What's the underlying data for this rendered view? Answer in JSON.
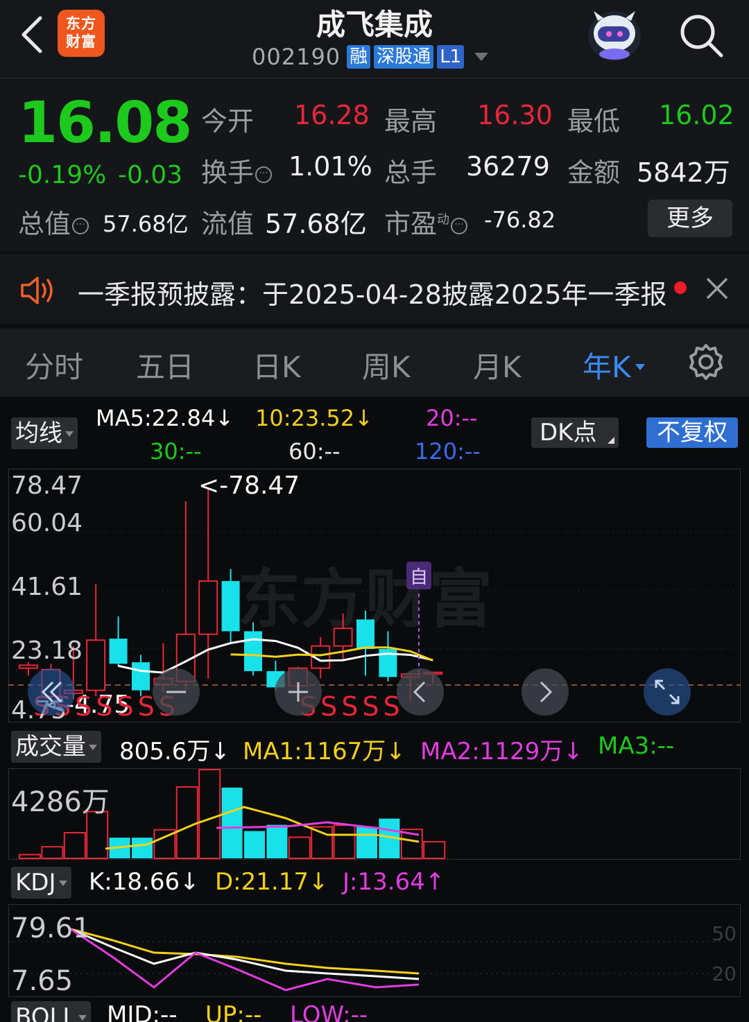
{
  "header": {
    "title": "成飞集成",
    "code": "002190",
    "tags": [
      "融",
      "深股通",
      "L1"
    ],
    "logo_line1": "东方",
    "logo_line2": "财富"
  },
  "quote": {
    "price": "16.08",
    "change_pct": "-0.19%",
    "change": "-0.03",
    "open_label": "今开",
    "open": "16.28",
    "high_label": "最高",
    "high": "16.30",
    "low_label": "最低",
    "low": "16.02",
    "turnover_label": "换手",
    "turnover": "1.01%",
    "volume_label": "总手",
    "volume": "36279",
    "amount_label": "金额",
    "amount": "5842万",
    "mcap_label": "总值",
    "mcap": "57.68亿",
    "float_label": "流值",
    "float_cap": "57.68亿",
    "pe_label": "市盈",
    "pe_sup": "动",
    "pe": "-76.82",
    "more": "更多",
    "info_glyph": "···"
  },
  "notice": {
    "text": "一季报预披露：于2025-04-28披露2025年一季报"
  },
  "tabs": [
    "分时",
    "五日",
    "日K",
    "周K",
    "月K",
    "年K"
  ],
  "kline": {
    "ma_label": "均线",
    "ma5": "MA5:22.84↓",
    "ma10": "10:23.52↓",
    "ma20": "20:--",
    "ma30": "30:--",
    "ma60": "60:--",
    "ma120": "120:--",
    "dk_label": "DK点",
    "adjust_label": "不复权",
    "y_labels": [
      "78.47",
      "60.04",
      "41.61",
      "23.18",
      "4.75"
    ],
    "max_marker": "<-78.47",
    "min_marker": "<-4.75",
    "watermark": "东方财富",
    "self_marker": "自",
    "s_marks_left": "SSSSSSS",
    "s_marks_right": "SSSSS"
  },
  "volume": {
    "label": "成交量",
    "current": "805.6万↓",
    "ma1": "MA1:1167万↓",
    "ma2": "MA2:1129万↓",
    "ma3": "MA3:--",
    "y_max": "4286万"
  },
  "kdj": {
    "label": "KDJ",
    "k": "K:18.66↓",
    "d": "D:21.17↓",
    "j": "J:13.64↑",
    "y_top": "79.61",
    "y_bottom": "7.65",
    "level_50": "50",
    "level_20": "20"
  },
  "boll": {
    "label": "BOLL",
    "mid": "MID:--",
    "up": "UP:--",
    "low": "LOW:--"
  },
  "colors": {
    "up": "#e8283a",
    "down": "#1ec91e",
    "cyan_candle": "#19e1ea",
    "accent": "#3b8cf2",
    "ma5": "#ffffff",
    "ma10": "#f4d11a",
    "ma20": "#e03ee0",
    "ma120": "#3a6cf0"
  },
  "chart_data": {
    "type": "candlestick",
    "note_period": "年K",
    "candles": [
      {
        "o": 17.5,
        "h": 19.5,
        "l": 15.0,
        "c": 18.5
      },
      {
        "o": 8.0,
        "h": 19.0,
        "l": 4.75,
        "c": 17.0
      },
      {
        "o": 9.0,
        "h": 25.0,
        "l": 7.0,
        "c": 10.0
      },
      {
        "o": 10.0,
        "h": 46.0,
        "l": 8.0,
        "c": 27.0
      },
      {
        "o": 27.5,
        "h": 35.0,
        "l": 18.0,
        "c": 19.0
      },
      {
        "o": 19.5,
        "h": 22.0,
        "l": 8.0,
        "c": 10.0
      },
      {
        "o": 12.0,
        "h": 26.0,
        "l": 9.5,
        "c": 14.0
      },
      {
        "o": 13.0,
        "h": 74.0,
        "l": 10.0,
        "c": 29.0
      },
      {
        "o": 29.0,
        "h": 78.47,
        "l": 14.0,
        "c": 47.0
      },
      {
        "o": 47.0,
        "h": 51.0,
        "l": 26.0,
        "c": 30.0
      },
      {
        "o": 30.0,
        "h": 33.0,
        "l": 15.0,
        "c": 16.5
      },
      {
        "o": 16.5,
        "h": 20.0,
        "l": 10.0,
        "c": 11.0
      },
      {
        "o": 11.5,
        "h": 18.0,
        "l": 9.5,
        "c": 17.5
      },
      {
        "o": 17.5,
        "h": 28.0,
        "l": 14.0,
        "c": 25.0
      },
      {
        "o": 25.0,
        "h": 36.0,
        "l": 20.0,
        "c": 31.0
      },
      {
        "o": 34.0,
        "h": 37.0,
        "l": 15.0,
        "c": 24.0
      },
      {
        "o": 24.0,
        "h": 30.0,
        "l": 13.0,
        "c": 14.5
      },
      {
        "o": 14.5,
        "h": 16.0,
        "l": 6.0,
        "c": 15.5
      },
      {
        "o": 15.5,
        "h": 16.3,
        "l": 12.0,
        "c": 16.08
      }
    ],
    "volume_wan": [
      180,
      560,
      1240,
      2260,
      1000,
      1000,
      1380,
      3450,
      4286,
      3420,
      1320,
      1620,
      1020,
      1520,
      1600,
      1520,
      1920,
      1400,
      805.6
    ],
    "kdj_k": [
      79.61,
      72,
      60,
      45,
      58,
      55,
      48,
      40,
      30,
      25,
      22,
      18.66
    ],
    "kdj_d": [
      79.61,
      74,
      66,
      60,
      62,
      58,
      52,
      45,
      38,
      30,
      25,
      21.17
    ],
    "kdj_j": [
      79.61,
      68,
      40,
      15,
      55,
      50,
      35,
      20,
      8,
      12,
      15,
      13.64
    ],
    "ylim": [
      4.75,
      78.47
    ]
  }
}
